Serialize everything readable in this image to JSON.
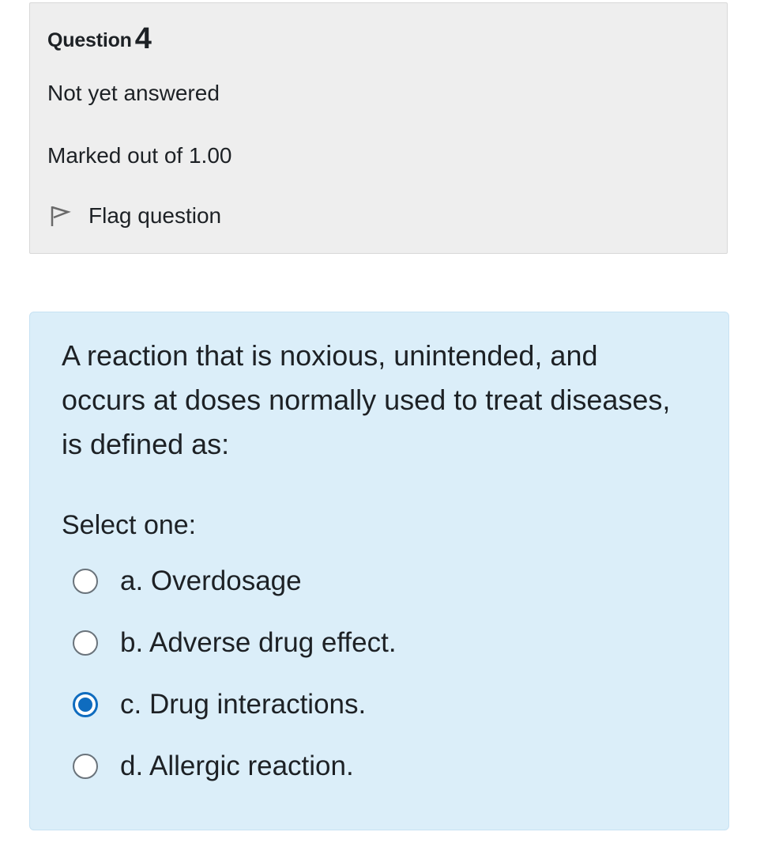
{
  "info": {
    "question_label": "Question",
    "question_number": "4",
    "state": "Not yet answered",
    "grade": "Marked out of 1.00",
    "flag_label": "Flag question",
    "flag_icon": "flag-icon"
  },
  "question": {
    "text": "A reaction that is noxious, unintended, and occurs at doses normally used to treat diseases, is defined as:",
    "prompt": "Select one:",
    "options": [
      {
        "label": "a. Overdosage",
        "selected": false
      },
      {
        "label": "b. Adverse drug effect.",
        "selected": false
      },
      {
        "label": "c. Drug interactions.",
        "selected": true
      },
      {
        "label": "d. Allergic reaction.",
        "selected": false
      }
    ]
  },
  "colors": {
    "info_background": "#eeeeee",
    "content_background": "#dbeef9",
    "accent": "#0f6cbf"
  }
}
